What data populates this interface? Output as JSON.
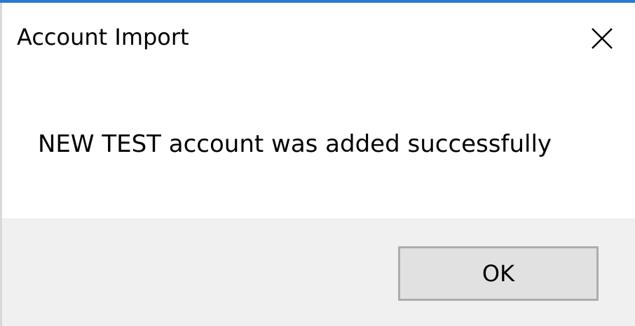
{
  "dialog": {
    "title": "Account Import",
    "close_icon": "close-icon",
    "message": "NEW TEST account was added successfully",
    "ok_label": "OK"
  },
  "colors": {
    "accent_border": "#2b79d0",
    "footer_bg": "#f0f0f0",
    "button_bg": "#e1e1e1",
    "button_border": "#adadad"
  }
}
